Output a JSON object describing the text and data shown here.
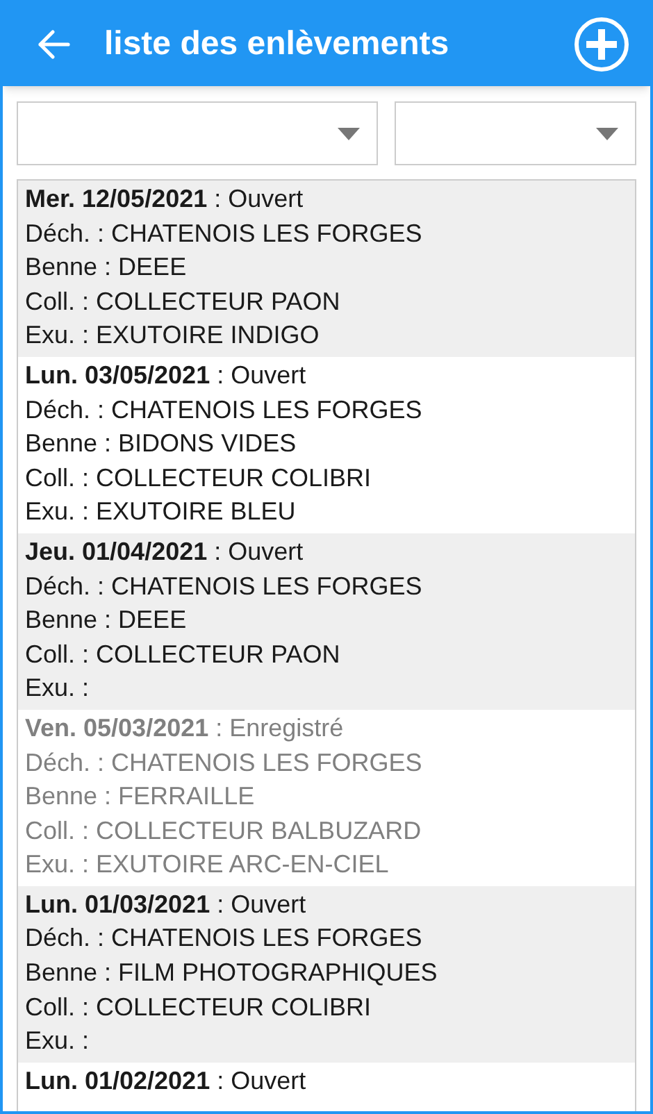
{
  "header": {
    "title": "liste des enlèvements"
  },
  "filters": [
    {
      "kind": "dropdown"
    },
    {
      "kind": "dropdown"
    }
  ],
  "pickups": [
    {
      "title": "**Mer. 12/05/2021** : Ouvert",
      "greyed": false,
      "lines": [
        "Déch. : CHATENOIS LES FORGES",
        "Benne : DEEE",
        "Coll. : COLLECTEUR PAON",
        "Exu. : EXUTOIRE INDIGO"
      ]
    },
    {
      "title": "**Lun. 03/05/2021** : Ouvert",
      "greyed": false,
      "lines": [
        "Déch. : CHATENOIS LES FORGES",
        "Benne : BIDONS VIDES",
        "Coll. : COLLECTEUR COLIBRI",
        "Exu. : EXUTOIRE BLEU"
      ]
    },
    {
      "title": "**Jeu. 01/04/2021** : Ouvert",
      "greyed": false,
      "lines": [
        "Déch. : CHATENOIS LES FORGES",
        "Benne : DEEE",
        "Coll. : COLLECTEUR PAON",
        "Exu. :"
      ]
    },
    {
      "title": "**Ven. 05/03/2021** : Enregistré",
      "greyed": true,
      "lines": [
        "Déch. : CHATENOIS LES FORGES",
        "Benne : FERRAILLE",
        "Coll. : COLLECTEUR BALBUZARD",
        "Exu. : EXUTOIRE ARC-EN-CIEL"
      ]
    },
    {
      "title": "**Lun. 01/03/2021** : Ouvert",
      "greyed": false,
      "lines": [
        "Déch. : CHATENOIS LES FORGES",
        "Benne : FILM PHOTOGRAPHIQUES",
        "Coll. : COLLECTEUR COLIBRI",
        "Exu. :"
      ]
    },
    {
      "title": "**Lun. 01/02/2021** : Ouvert",
      "greyed": false
    }
  ]
}
